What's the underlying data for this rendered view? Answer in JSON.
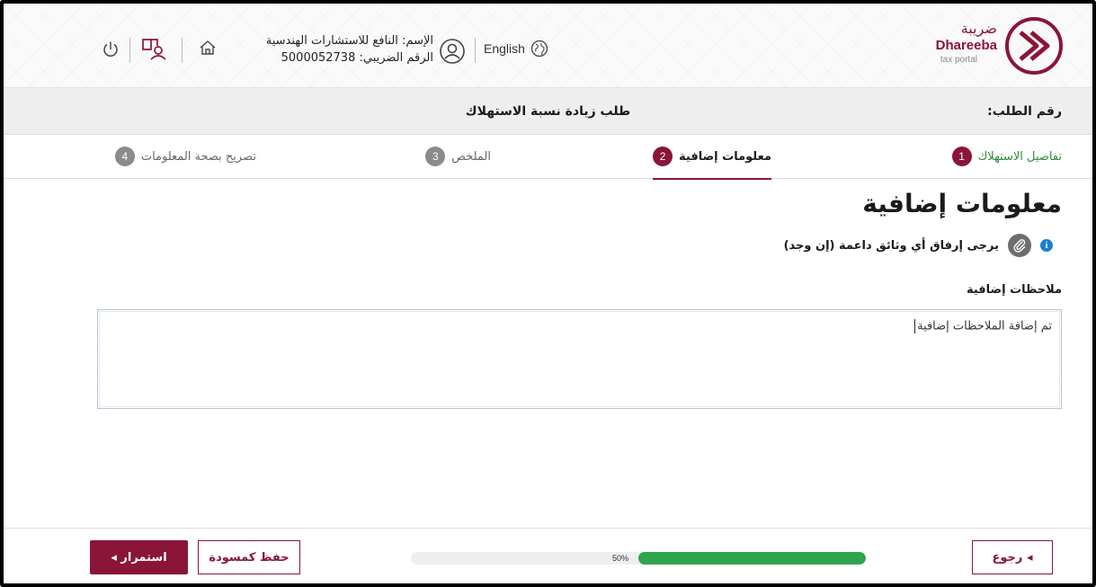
{
  "header": {
    "logo": {
      "arabic": "ضريبة",
      "english": "Dhareeba",
      "tagline": "tax portal"
    },
    "language_label": "English",
    "user_name": "الإسم: النافع للاستشارات الهندسية",
    "tax_number": "الرقم الضريبي: 5000052738",
    "icons": [
      "globe-icon",
      "user-avatar-icon",
      "home-icon",
      "switch-account-icon",
      "power-icon"
    ]
  },
  "request": {
    "number_label": "رقم الطلب:",
    "title": "طلب زيادة نسبة الاستهلاك"
  },
  "steps": [
    {
      "num": "1",
      "label": "تفاصيل الاستهلاك",
      "state": "done"
    },
    {
      "num": "2",
      "label": "معلومات إضافية",
      "state": "active"
    },
    {
      "num": "3",
      "label": "الملخص",
      "state": "pending"
    },
    {
      "num": "4",
      "label": "تصريح بصحة المعلومات",
      "state": "pending"
    }
  ],
  "main": {
    "title": "معلومات إضافية",
    "attach_text": "يرجى إرفاق أي وثائق داعمة (إن وجد)",
    "notes_label": "ملاحظات إضافية",
    "notes_value": "تم إضافة الملاحظات إضافية"
  },
  "footer": {
    "back_label": "◂ رجوع",
    "continue_label": "استمرار ◂",
    "draft_label": "حفظ كمسودة",
    "progress_percent": 50,
    "progress_text": "50%"
  },
  "colors": {
    "brand": "#8a1538",
    "success": "#2ea44f",
    "info": "#1b7fd1"
  }
}
